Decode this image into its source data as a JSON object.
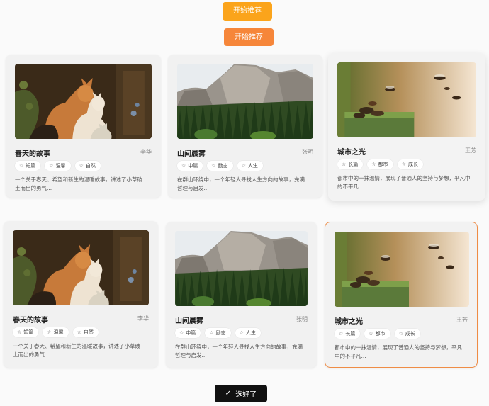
{
  "buttons": {
    "start_recommend_1": "开始推荐",
    "start_recommend_2": "开始推荐",
    "done": "选好了"
  },
  "cards": [
    {
      "title": "春天的故事",
      "author": "李华",
      "tags": [
        "短篇",
        "温馨",
        "自然"
      ],
      "desc": "一个关于春天、希望和新生的温暖故事，讲述了小草破土而出的勇气...",
      "image": "cats"
    },
    {
      "title": "山间晨雾",
      "author": "张明",
      "tags": [
        "中篇",
        "励志",
        "人生"
      ],
      "desc": "在群山环绕中，一个年轻人寻找人生方向的故事，充满哲理与启发...",
      "image": "mountain"
    },
    {
      "title": "城市之光",
      "author": "王芳",
      "tags": [
        "长篇",
        "都市",
        "成长"
      ],
      "desc": "都市中的一抹温情，展现了普通人的坚持与梦想，平凡中的不平凡...",
      "image": "bees"
    },
    {
      "title": "春天的故事",
      "author": "李华",
      "tags": [
        "短篇",
        "温馨",
        "自然"
      ],
      "desc": "一个关于春天、希望和新生的温暖故事，讲述了小草破土而出的勇气...",
      "image": "cats"
    },
    {
      "title": "山间晨雾",
      "author": "张明",
      "tags": [
        "中篇",
        "励志",
        "人生"
      ],
      "desc": "在群山环绕中，一个年轻人寻找人生方向的故事，充满哲理与启发...",
      "image": "mountain"
    },
    {
      "title": "城市之光",
      "author": "王芳",
      "tags": [
        "长篇",
        "都市",
        "成长"
      ],
      "desc": "都市中的一抹温情，展现了普通人的坚持与梦想，平凡中的不平凡...",
      "image": "bees"
    }
  ]
}
